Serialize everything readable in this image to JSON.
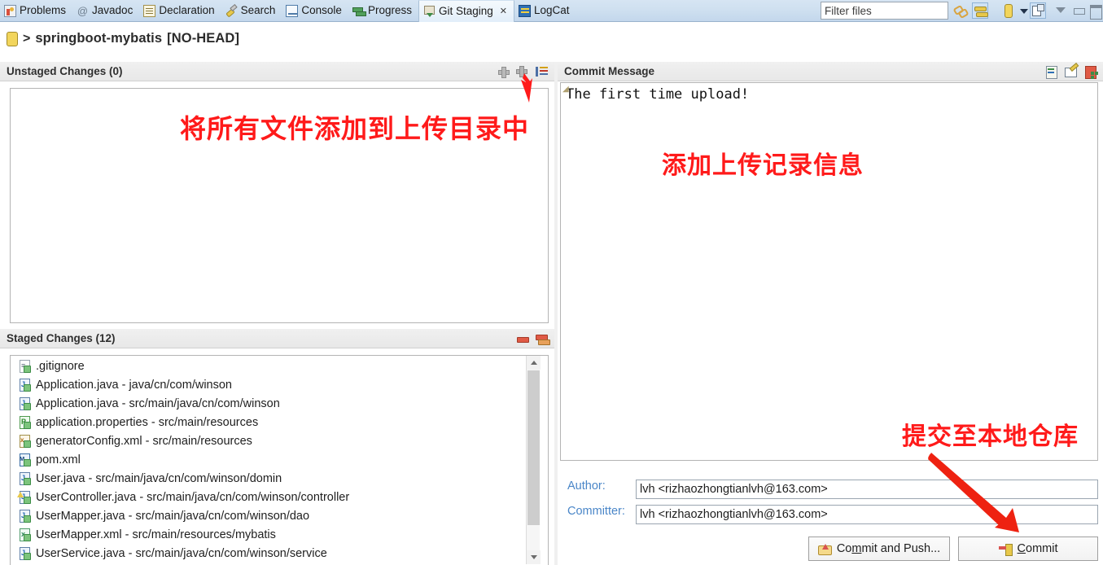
{
  "tabbar": {
    "tabs": [
      {
        "label": "Problems",
        "icon": "problems-icon",
        "active": false
      },
      {
        "label": "Javadoc",
        "icon": "javadoc-icon",
        "active": false
      },
      {
        "label": "Declaration",
        "icon": "declaration-icon",
        "active": false
      },
      {
        "label": "Search",
        "icon": "search-icon",
        "active": false
      },
      {
        "label": "Console",
        "icon": "console-icon",
        "active": false
      },
      {
        "label": "Progress",
        "icon": "progress-icon",
        "active": false
      },
      {
        "label": "Git Staging",
        "icon": "git-staging-icon",
        "active": true,
        "close": "✕"
      },
      {
        "label": "LogCat",
        "icon": "logcat-icon",
        "active": false
      }
    ],
    "filter": {
      "placeholder": "Filter files",
      "value": ""
    },
    "tools": [
      {
        "name": "link-with-editor-icon"
      },
      {
        "name": "refresh-sync-icon"
      },
      {
        "name": "repository-selector-icon"
      },
      {
        "name": "dropdown-caret-icon"
      },
      {
        "name": "switch-repository-icon"
      },
      {
        "name": "view-menu-icon"
      },
      {
        "name": "minimize-icon"
      },
      {
        "name": "maximize-icon"
      }
    ]
  },
  "repo_header": {
    "chevron": ">",
    "name": "springboot-mybatis",
    "state": "[NO-HEAD]",
    "full": "> springboot-mybatis [NO-HEAD]"
  },
  "unstaged": {
    "title": "Unstaged Changes (0)",
    "items": [],
    "tools": [
      {
        "name": "add-selected-icon"
      },
      {
        "name": "add-all-icon"
      },
      {
        "name": "presentation-menu-icon"
      }
    ]
  },
  "staged": {
    "title": "Staged Changes (12)",
    "tools": [
      {
        "name": "remove-selected-icon"
      },
      {
        "name": "remove-all-icon"
      }
    ],
    "items": [
      {
        "name": ".gitignore",
        "path": "",
        "icon": "text-file-icon"
      },
      {
        "name": "Application.java",
        "path": "java/cn/com/winson",
        "icon": "java-file-icon"
      },
      {
        "name": "Application.java",
        "path": "src/main/java/cn/com/winson",
        "icon": "java-file-icon"
      },
      {
        "name": "application.properties",
        "path": "src/main/resources",
        "icon": "properties-file-icon"
      },
      {
        "name": "generatorConfig.xml",
        "path": "src/main/resources",
        "icon": "xml-file-icon"
      },
      {
        "name": "pom.xml",
        "path": "",
        "icon": "maven-file-icon"
      },
      {
        "name": "User.java",
        "path": "src/main/java/cn/com/winson/domin",
        "icon": "java-file-icon"
      },
      {
        "name": "UserController.java",
        "path": "src/main/java/cn/com/winson/controller",
        "icon": "java-warning-file-icon"
      },
      {
        "name": "UserMapper.java",
        "path": "src/main/java/cn/com/winson/dao",
        "icon": "java-file-icon"
      },
      {
        "name": "UserMapper.xml",
        "path": "src/main/resources/mybatis",
        "icon": "mapper-xml-file-icon"
      },
      {
        "name": "UserService.java",
        "path": "src/main/java/cn/com/winson/service",
        "icon": "java-file-icon"
      }
    ],
    "separator": " - "
  },
  "commit_message": {
    "title": "Commit Message",
    "text": "The first time upload!",
    "tools": [
      {
        "name": "amend-commit-icon"
      },
      {
        "name": "sign-off-icon"
      },
      {
        "name": "add-change-id-icon"
      }
    ]
  },
  "author": {
    "label": "Author:",
    "value": "lvh <rizhaozhongtianlvh@163.com>"
  },
  "committer": {
    "label": "Committer:",
    "value": "lvh <rizhaozhongtianlvh@163.com>"
  },
  "buttons": {
    "commit_and_push": {
      "pre": "Co",
      "mnemonic": "m",
      "post": "mit and Push...",
      "icon": "commit-push-icon"
    },
    "commit": {
      "pre": "",
      "mnemonic": "C",
      "post": "ommit",
      "icon": "commit-icon"
    }
  },
  "annotations": [
    {
      "id": "anno-add-all-files",
      "text": "将所有文件添加到上传目录中"
    },
    {
      "id": "anno-add-commit-message",
      "text": "添加上传记录信息"
    },
    {
      "id": "anno-commit-to-local-repo",
      "text": "提交至本地仓库"
    }
  ],
  "colors": {
    "annotation_red": "#ff1a1a",
    "tabbar_blue": "#cfe0f0",
    "label_blue": "#4a86c8",
    "panel_bg": "#ffffff"
  }
}
